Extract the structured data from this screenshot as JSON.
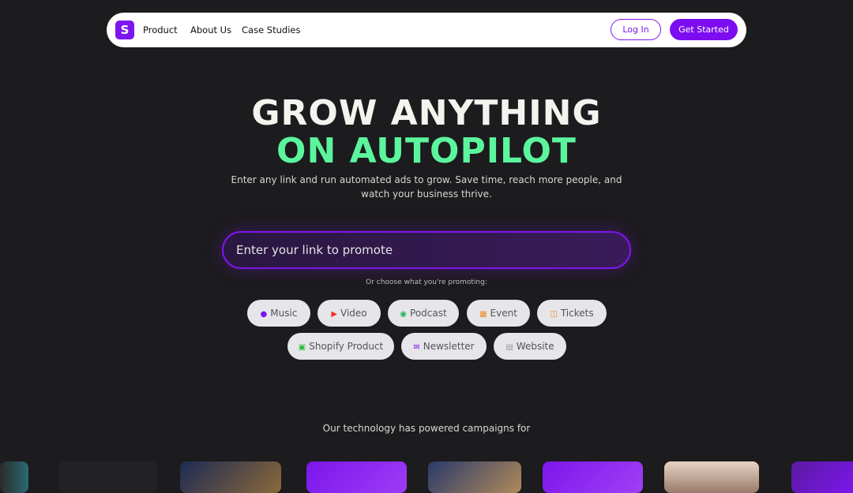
{
  "nav": {
    "logo_letter": "S",
    "links": [
      "Product",
      "About Us",
      "Case Studies"
    ],
    "login_label": "Log In",
    "get_started_label": "Get Started"
  },
  "hero": {
    "line1": "GROW ANYTHING",
    "line2": "ON AUTOPILOT",
    "subtitle": "Enter any link and run automated ads to grow. Save time, reach more people, and watch your business thrive."
  },
  "search": {
    "placeholder": "Enter your link to promote",
    "value": ""
  },
  "choose_label": "Or choose what you're promoting:",
  "categories": [
    {
      "label": "Music",
      "icon": "spotify-icon"
    },
    {
      "label": "Video",
      "icon": "youtube-icon"
    },
    {
      "label": "Podcast",
      "icon": "headphones-icon"
    },
    {
      "label": "Event",
      "icon": "calendar-icon"
    },
    {
      "label": "Tickets",
      "icon": "ticket-icon"
    },
    {
      "label": "Shopify Product",
      "icon": "shopify-icon"
    },
    {
      "label": "Newsletter",
      "icon": "mail-icon"
    },
    {
      "label": "Website",
      "icon": "document-icon"
    }
  ],
  "powered_label": "Our technology has powered campaigns for",
  "colors": {
    "background": "#1c1b1d",
    "brand_purple": "#7c16ec",
    "accent_green": "#5bf59e",
    "chip_background": "#e6e6ea"
  }
}
